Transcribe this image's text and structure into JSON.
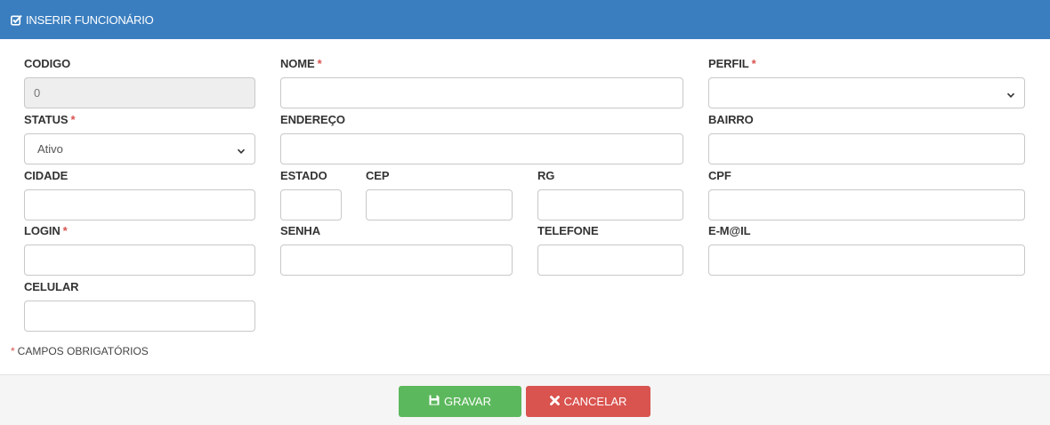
{
  "header": {
    "title": "INSERIR FUNCIONÁRIO",
    "icon": "edit-check-icon"
  },
  "labels": {
    "codigo": "CODIGO",
    "nome": "NOME",
    "perfil": "PERFIL",
    "status": "STATUS",
    "endereco": "ENDEREÇO",
    "bairro": "BAIRRO",
    "cidade": "CIDADE",
    "estado": "ESTADO",
    "cep": "CEP",
    "rg": "RG",
    "cpf": "CPF",
    "login": "LOGIN",
    "senha": "SENHA",
    "telefone": "TELEFONE",
    "email": "E-M@IL",
    "celular": "CELULAR"
  },
  "required_mark": "*",
  "values": {
    "codigo": "0",
    "status": "Ativo",
    "perfil": ""
  },
  "note": {
    "star": "*",
    "text": "CAMPOS OBRIGATÓRIOS"
  },
  "buttons": {
    "save": "GRAVAR",
    "cancel": "CANCELAR"
  },
  "colors": {
    "header": "#3a7ebf",
    "save": "#5cb85c",
    "cancel": "#d9534f",
    "required": "#d9534f"
  }
}
